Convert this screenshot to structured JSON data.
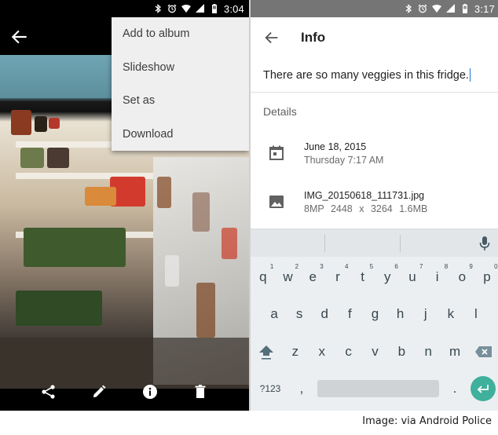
{
  "left_screen": {
    "status_bar": {
      "time": "3:04",
      "icons": [
        "bluetooth-icon",
        "alarm-icon",
        "wifi-icon",
        "signal-icon",
        "battery-icon"
      ]
    },
    "overflow_menu": {
      "items": [
        {
          "label": "Add to album"
        },
        {
          "label": "Slideshow"
        },
        {
          "label": "Set as"
        },
        {
          "label": "Download"
        }
      ]
    },
    "bottom_actions": [
      "share-icon",
      "edit-icon",
      "info-icon",
      "delete-icon"
    ]
  },
  "right_screen": {
    "status_bar": {
      "time": "3:17",
      "icons": [
        "bluetooth-icon",
        "alarm-icon",
        "wifi-icon",
        "signal-icon",
        "battery-icon"
      ]
    },
    "title": "Info",
    "caption_value": "There are so many veggies in this fridge.",
    "details_heading": "Details",
    "details": [
      {
        "icon": "calendar-icon",
        "primary": "June 18, 2015",
        "secondary": "Thursday 7:17 AM"
      },
      {
        "icon": "image-icon",
        "primary": "IMG_20150618_111731.jpg",
        "secondary": "8MP  2448 x 3264  1.6MB"
      }
    ],
    "keyboard": {
      "row1": [
        {
          "key": "q",
          "hint": "1"
        },
        {
          "key": "w",
          "hint": "2"
        },
        {
          "key": "e",
          "hint": "3"
        },
        {
          "key": "r",
          "hint": "4"
        },
        {
          "key": "t",
          "hint": "5"
        },
        {
          "key": "y",
          "hint": "6"
        },
        {
          "key": "u",
          "hint": "7"
        },
        {
          "key": "i",
          "hint": "8"
        },
        {
          "key": "o",
          "hint": "9"
        },
        {
          "key": "p",
          "hint": "0"
        }
      ],
      "row2": [
        "a",
        "s",
        "d",
        "f",
        "g",
        "h",
        "j",
        "k",
        "l"
      ],
      "row3": [
        "z",
        "x",
        "c",
        "v",
        "b",
        "n",
        "m"
      ],
      "symbols_label": "?123",
      "comma": ",",
      "period": "."
    }
  },
  "credit": "Image: via Android Police"
}
